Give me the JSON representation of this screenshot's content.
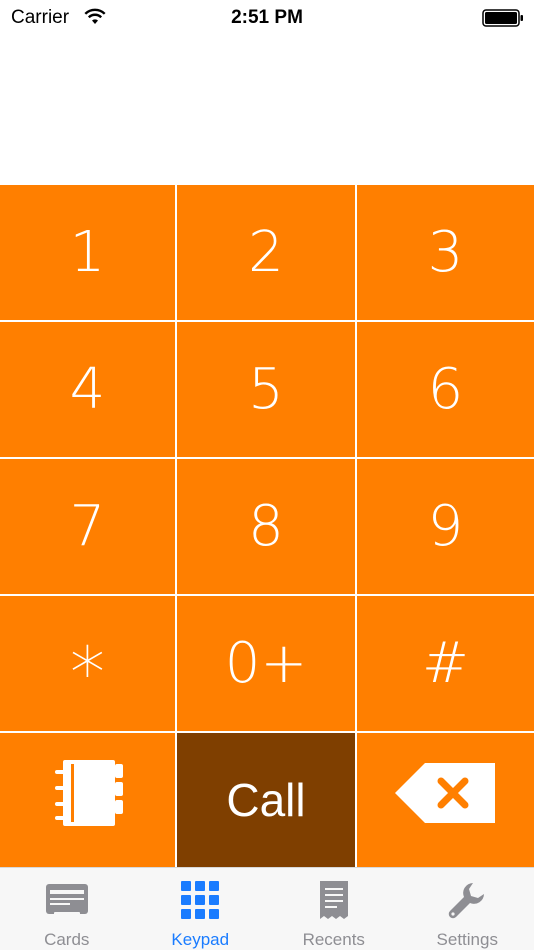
{
  "status_bar": {
    "carrier": "Carrier",
    "time": "2:51 PM"
  },
  "keypad": {
    "keys": [
      {
        "label": "1"
      },
      {
        "label": "2"
      },
      {
        "label": "3"
      },
      {
        "label": "4"
      },
      {
        "label": "5"
      },
      {
        "label": "6"
      },
      {
        "label": "7"
      },
      {
        "label": "8"
      },
      {
        "label": "9"
      },
      {
        "label": "*"
      },
      {
        "label": "0+"
      },
      {
        "label": "#"
      }
    ],
    "call_label": "Call"
  },
  "tabs": [
    {
      "label": "Cards",
      "icon": "card-icon",
      "active": false
    },
    {
      "label": "Keypad",
      "icon": "keypad-grid-icon",
      "active": true
    },
    {
      "label": "Recents",
      "icon": "receipt-icon",
      "active": false
    },
    {
      "label": "Settings",
      "icon": "wrench-icon",
      "active": false
    }
  ],
  "colors": {
    "key_orange": "#ff7f00",
    "call_brown": "#7f3f00",
    "tab_active": "#1a7cff",
    "tab_inactive": "#8e8e93"
  }
}
